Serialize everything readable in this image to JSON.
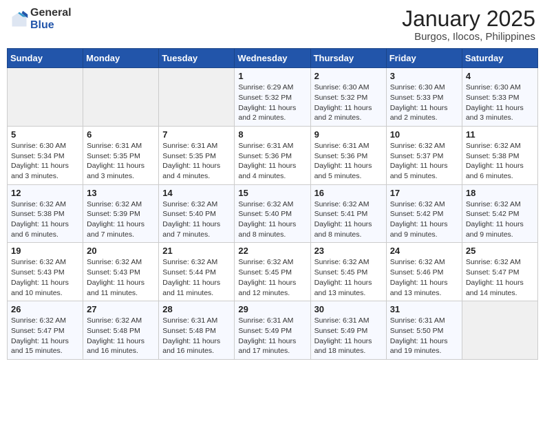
{
  "header": {
    "logo_general": "General",
    "logo_blue": "Blue",
    "title": "January 2025",
    "subtitle": "Burgos, Ilocos, Philippines"
  },
  "weekdays": [
    "Sunday",
    "Monday",
    "Tuesday",
    "Wednesday",
    "Thursday",
    "Friday",
    "Saturday"
  ],
  "weeks": [
    [
      {
        "day": "",
        "info": ""
      },
      {
        "day": "",
        "info": ""
      },
      {
        "day": "",
        "info": ""
      },
      {
        "day": "1",
        "info": "Sunrise: 6:29 AM\nSunset: 5:32 PM\nDaylight: 11 hours\nand 2 minutes."
      },
      {
        "day": "2",
        "info": "Sunrise: 6:30 AM\nSunset: 5:32 PM\nDaylight: 11 hours\nand 2 minutes."
      },
      {
        "day": "3",
        "info": "Sunrise: 6:30 AM\nSunset: 5:33 PM\nDaylight: 11 hours\nand 2 minutes."
      },
      {
        "day": "4",
        "info": "Sunrise: 6:30 AM\nSunset: 5:33 PM\nDaylight: 11 hours\nand 3 minutes."
      }
    ],
    [
      {
        "day": "5",
        "info": "Sunrise: 6:30 AM\nSunset: 5:34 PM\nDaylight: 11 hours\nand 3 minutes."
      },
      {
        "day": "6",
        "info": "Sunrise: 6:31 AM\nSunset: 5:35 PM\nDaylight: 11 hours\nand 3 minutes."
      },
      {
        "day": "7",
        "info": "Sunrise: 6:31 AM\nSunset: 5:35 PM\nDaylight: 11 hours\nand 4 minutes."
      },
      {
        "day": "8",
        "info": "Sunrise: 6:31 AM\nSunset: 5:36 PM\nDaylight: 11 hours\nand 4 minutes."
      },
      {
        "day": "9",
        "info": "Sunrise: 6:31 AM\nSunset: 5:36 PM\nDaylight: 11 hours\nand 5 minutes."
      },
      {
        "day": "10",
        "info": "Sunrise: 6:32 AM\nSunset: 5:37 PM\nDaylight: 11 hours\nand 5 minutes."
      },
      {
        "day": "11",
        "info": "Sunrise: 6:32 AM\nSunset: 5:38 PM\nDaylight: 11 hours\nand 6 minutes."
      }
    ],
    [
      {
        "day": "12",
        "info": "Sunrise: 6:32 AM\nSunset: 5:38 PM\nDaylight: 11 hours\nand 6 minutes."
      },
      {
        "day": "13",
        "info": "Sunrise: 6:32 AM\nSunset: 5:39 PM\nDaylight: 11 hours\nand 7 minutes."
      },
      {
        "day": "14",
        "info": "Sunrise: 6:32 AM\nSunset: 5:40 PM\nDaylight: 11 hours\nand 7 minutes."
      },
      {
        "day": "15",
        "info": "Sunrise: 6:32 AM\nSunset: 5:40 PM\nDaylight: 11 hours\nand 8 minutes."
      },
      {
        "day": "16",
        "info": "Sunrise: 6:32 AM\nSunset: 5:41 PM\nDaylight: 11 hours\nand 8 minutes."
      },
      {
        "day": "17",
        "info": "Sunrise: 6:32 AM\nSunset: 5:42 PM\nDaylight: 11 hours\nand 9 minutes."
      },
      {
        "day": "18",
        "info": "Sunrise: 6:32 AM\nSunset: 5:42 PM\nDaylight: 11 hours\nand 9 minutes."
      }
    ],
    [
      {
        "day": "19",
        "info": "Sunrise: 6:32 AM\nSunset: 5:43 PM\nDaylight: 11 hours\nand 10 minutes."
      },
      {
        "day": "20",
        "info": "Sunrise: 6:32 AM\nSunset: 5:43 PM\nDaylight: 11 hours\nand 11 minutes."
      },
      {
        "day": "21",
        "info": "Sunrise: 6:32 AM\nSunset: 5:44 PM\nDaylight: 11 hours\nand 11 minutes."
      },
      {
        "day": "22",
        "info": "Sunrise: 6:32 AM\nSunset: 5:45 PM\nDaylight: 11 hours\nand 12 minutes."
      },
      {
        "day": "23",
        "info": "Sunrise: 6:32 AM\nSunset: 5:45 PM\nDaylight: 11 hours\nand 13 minutes."
      },
      {
        "day": "24",
        "info": "Sunrise: 6:32 AM\nSunset: 5:46 PM\nDaylight: 11 hours\nand 13 minutes."
      },
      {
        "day": "25",
        "info": "Sunrise: 6:32 AM\nSunset: 5:47 PM\nDaylight: 11 hours\nand 14 minutes."
      }
    ],
    [
      {
        "day": "26",
        "info": "Sunrise: 6:32 AM\nSunset: 5:47 PM\nDaylight: 11 hours\nand 15 minutes."
      },
      {
        "day": "27",
        "info": "Sunrise: 6:32 AM\nSunset: 5:48 PM\nDaylight: 11 hours\nand 16 minutes."
      },
      {
        "day": "28",
        "info": "Sunrise: 6:31 AM\nSunset: 5:48 PM\nDaylight: 11 hours\nand 16 minutes."
      },
      {
        "day": "29",
        "info": "Sunrise: 6:31 AM\nSunset: 5:49 PM\nDaylight: 11 hours\nand 17 minutes."
      },
      {
        "day": "30",
        "info": "Sunrise: 6:31 AM\nSunset: 5:49 PM\nDaylight: 11 hours\nand 18 minutes."
      },
      {
        "day": "31",
        "info": "Sunrise: 6:31 AM\nSunset: 5:50 PM\nDaylight: 11 hours\nand 19 minutes."
      },
      {
        "day": "",
        "info": ""
      }
    ]
  ]
}
